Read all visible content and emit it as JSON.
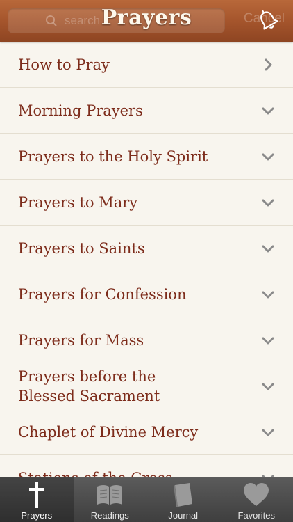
{
  "header": {
    "title": "Prayers",
    "search_placeholder": "search",
    "cancel_label": "Cancel"
  },
  "list": {
    "items": [
      {
        "label": "How to Pray",
        "chevron": "chevron-right"
      },
      {
        "label": "Morning Prayers",
        "chevron": "chevron-down"
      },
      {
        "label": "Prayers to the Holy Spirit",
        "chevron": "chevron-down"
      },
      {
        "label": "Prayers to Mary",
        "chevron": "chevron-down"
      },
      {
        "label": "Prayers to Saints",
        "chevron": "chevron-down"
      },
      {
        "label": "Prayers for Confession",
        "chevron": "chevron-down"
      },
      {
        "label": "Prayers for Mass",
        "chevron": "chevron-down"
      },
      {
        "label": "Prayers before the\nBlessed Sacrament",
        "chevron": "chevron-down"
      },
      {
        "label": "Chaplet of Divine Mercy",
        "chevron": "chevron-down"
      },
      {
        "label": "Stations of the Cross",
        "chevron": "chevron-down"
      }
    ]
  },
  "tabbar": {
    "tabs": [
      {
        "label": "Prayers",
        "icon": "cross-icon",
        "active": true
      },
      {
        "label": "Readings",
        "icon": "open-book-icon",
        "active": false
      },
      {
        "label": "Journal",
        "icon": "journal-icon",
        "active": false
      },
      {
        "label": "Favorites",
        "icon": "heart-icon",
        "active": false
      }
    ]
  },
  "colors": {
    "header_brown": "#a5552c",
    "item_text": "#7d2c1b",
    "background": "#f8f5ee",
    "chevron": "#8a8a8a",
    "tabbar": "#4a4a4a"
  }
}
